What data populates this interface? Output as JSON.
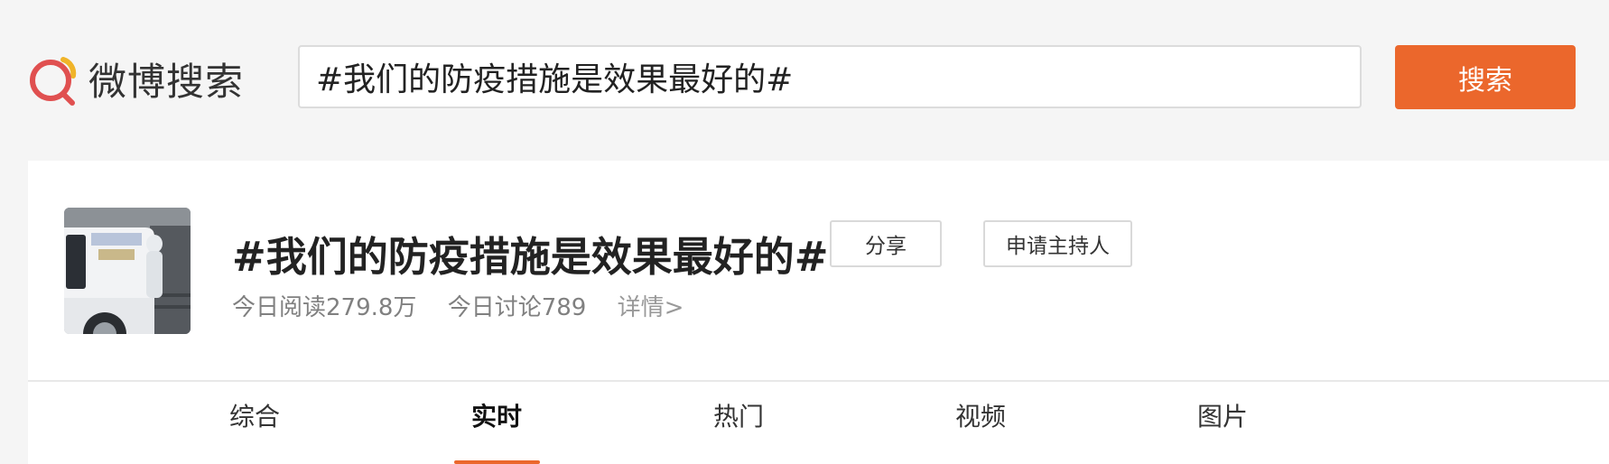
{
  "brand": {
    "logo_text": "微博搜索",
    "accent_color": "#eb672c"
  },
  "search": {
    "value": "#我们的防疫措施是效果最好的#",
    "button_label": "搜索"
  },
  "topic": {
    "title": "#我们的防疫措施是效果最好的#",
    "share_label": "分享",
    "host_label": "申请主持人",
    "reads": "今日阅读279.8万",
    "discussions": "今日讨论789",
    "details_link": "详情>"
  },
  "tabs": [
    {
      "label": "综合",
      "active": false
    },
    {
      "label": "实时",
      "active": true
    },
    {
      "label": "热门",
      "active": false
    },
    {
      "label": "视频",
      "active": false
    },
    {
      "label": "图片",
      "active": false
    }
  ]
}
